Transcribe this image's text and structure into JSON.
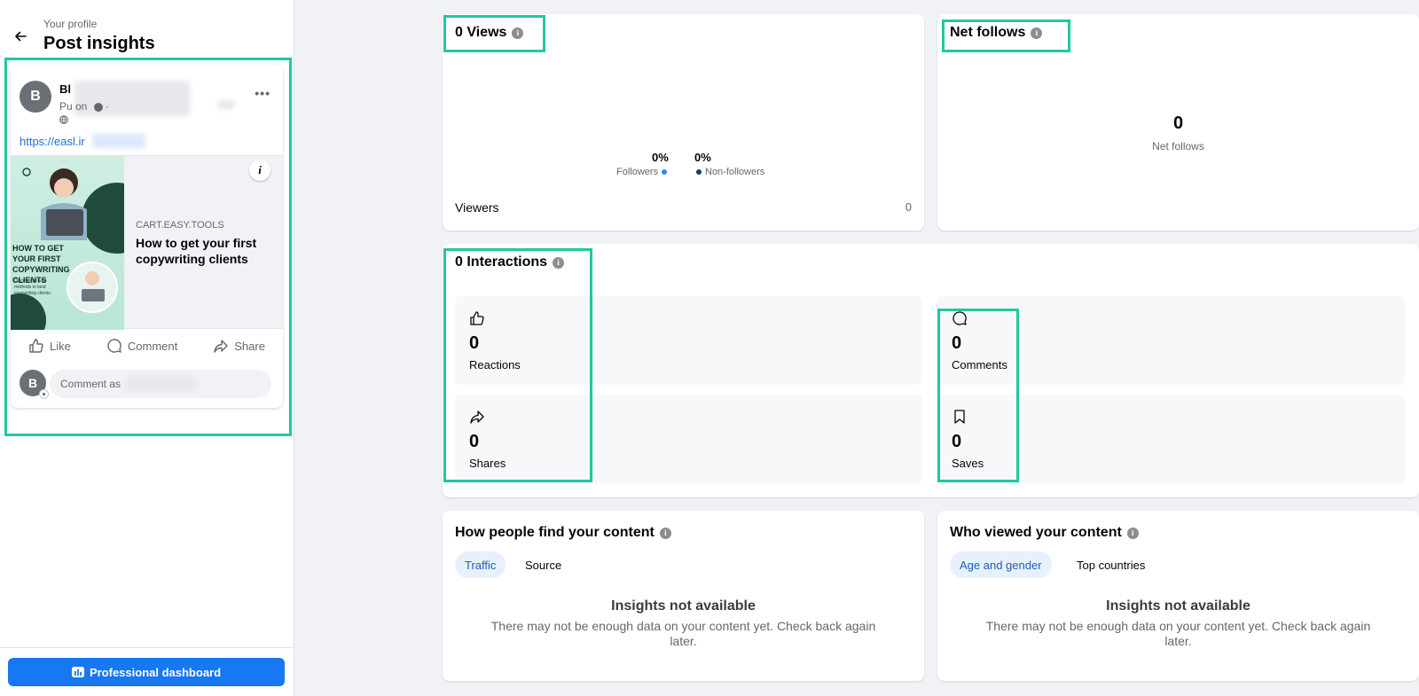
{
  "sidebar": {
    "breadcrumb": "Your profile",
    "title": "Post insights",
    "post": {
      "avatar_letter": "B",
      "author_name": "Bl",
      "meta_line": "Pu                              on",
      "link": "https://easl.ir",
      "preview_image_heading": "HOW TO GET YOUR FIRST COPYWRITING CLIENTS",
      "preview_image_sub": "Discover proven methods to land copywriting clients.",
      "domain": "CART.EASY.TOOLS",
      "link_title": "How to get your first copywriting clients",
      "actions": {
        "like": "Like",
        "comment": "Comment",
        "share": "Share"
      },
      "comment_placeholder": "Comment as"
    },
    "dashboard_button": "Professional dashboard"
  },
  "views": {
    "title": "0 Views",
    "followers_pct": "0%",
    "followers_label": "Followers",
    "nonfollowers_pct": "0%",
    "nonfollowers_label": "Non-followers",
    "viewers_label": "Viewers",
    "viewers_value": "0"
  },
  "net_follows": {
    "title": "Net follows",
    "value": "0",
    "label": "Net follows"
  },
  "interactions": {
    "title": "0 Interactions",
    "reactions": {
      "value": "0",
      "label": "Reactions"
    },
    "comments": {
      "value": "0",
      "label": "Comments"
    },
    "shares": {
      "value": "0",
      "label": "Shares"
    },
    "saves": {
      "value": "0",
      "label": "Saves"
    }
  },
  "find_content": {
    "title": "How people find your content",
    "tab_traffic": "Traffic",
    "tab_source": "Source",
    "na_title": "Insights not available",
    "na_text": "There may not be enough data on your content yet. Check back again later."
  },
  "who_viewed": {
    "title": "Who viewed your content",
    "tab_age": "Age and gender",
    "tab_countries": "Top countries",
    "na_title": "Insights not available",
    "na_text": "There may not be enough data on your content yet. Check back again later."
  },
  "colors": {
    "highlight": "#22c7a1",
    "primary_blue": "#1877f2",
    "followers_dot": "#2d88ff",
    "nonfollowers_dot": "#0a3d7a"
  }
}
